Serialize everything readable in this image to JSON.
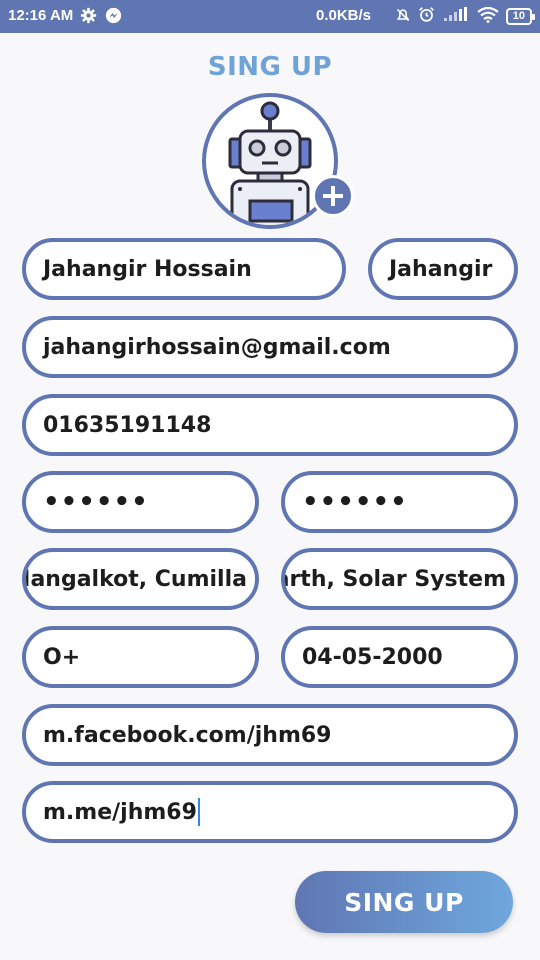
{
  "status_bar": {
    "time": "12:16 AM",
    "network_speed": "0.0KB/s",
    "battery": "10"
  },
  "header": {
    "title": "SING UP"
  },
  "avatar": {
    "image": "robot-avatar",
    "add_icon": "plus-icon"
  },
  "form": {
    "full_name": "Jahangir Hossain",
    "nickname": "Jahangir",
    "email": "jahangirhossain@gmail.com",
    "phone": "01635191148",
    "password": "••••••",
    "confirm_password": "••••••",
    "address": "Nangalkot, Cumilla",
    "planet": "Earth, Solar System",
    "blood_group": "O+",
    "birth_date": "04-05-2000",
    "facebook": "m.facebook.com/jhm69",
    "messenger": "m.me/jhm69"
  },
  "submit_label": "SING UP",
  "colors": {
    "primary": "#5f76b3",
    "accent": "#6fa3d6",
    "background": "#f8f8fa"
  }
}
